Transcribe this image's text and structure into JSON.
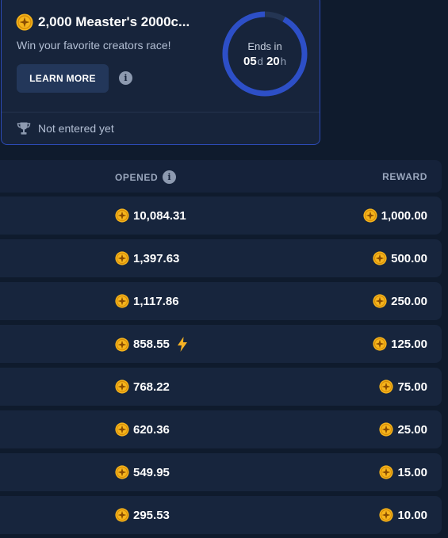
{
  "race": {
    "title": "2,000 Measter's 2000c...",
    "subtitle": "Win your favorite creators race!",
    "learn_more_label": "LEARN MORE",
    "info_icon": "info-icon",
    "timer": {
      "label": "Ends in",
      "days": "05",
      "days_unit": "d",
      "hours": "20",
      "hours_unit": "h",
      "elapsed_fraction": 0.08
    },
    "entry_status": "Not entered yet",
    "status_icon": "trophy-icon"
  },
  "leaderboard": {
    "columns": {
      "opened": "OPENED",
      "reward": "REWARD"
    },
    "rows": [
      {
        "opened": "10,084.31",
        "reward": "1,000.00",
        "boost": false
      },
      {
        "opened": "1,397.63",
        "reward": "500.00",
        "boost": false
      },
      {
        "opened": "1,117.86",
        "reward": "250.00",
        "boost": false
      },
      {
        "opened": "858.55",
        "reward": "125.00",
        "boost": true
      },
      {
        "opened": "768.22",
        "reward": "75.00",
        "boost": false
      },
      {
        "opened": "620.36",
        "reward": "25.00",
        "boost": false
      },
      {
        "opened": "549.95",
        "reward": "15.00",
        "boost": false
      },
      {
        "opened": "295.53",
        "reward": "10.00",
        "boost": false
      }
    ]
  },
  "colors": {
    "background": "#0f1b2d",
    "card": "#17243b",
    "card_border": "#2c4bb8",
    "timer_ring": "#2d4fc7",
    "timer_track": "#243553",
    "coin": "#f5b41c",
    "bolt": "#f6b224",
    "muted_text": "#9aa7bd"
  }
}
